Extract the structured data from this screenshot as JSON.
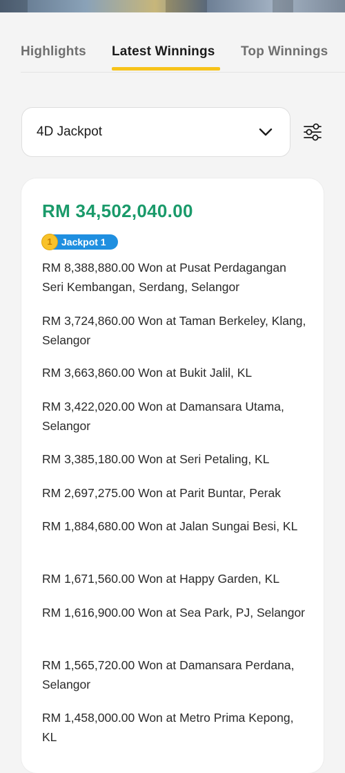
{
  "tabs": [
    {
      "label": "Highlights",
      "active": false
    },
    {
      "label": "Latest Winnings",
      "active": true
    },
    {
      "label": "Top Winnings",
      "active": false
    }
  ],
  "game_select": {
    "value": "4D Jackpot"
  },
  "icons": {
    "dropdown": "chevron-down-icon",
    "filter": "sliders-icon",
    "badge_coin": "coin-icon"
  },
  "colors": {
    "accent_tab": "#f7c31a",
    "amount_green": "#1a9a6a",
    "badge_blue": "#1f8fe0",
    "coin_gold": "#f8c22a"
  },
  "result": {
    "total_amount": "RM 34,502,040.00",
    "badge_number": "1",
    "badge_label": "Jackpot 1",
    "winnings": [
      "RM 8,388,880.00 Won at Pusat Perdagangan Seri Kembangan, Serdang, Selangor",
      "RM 3,724,860.00 Won at Taman Berkeley, Klang, Selangor",
      "RM 3,663,860.00 Won at Bukit Jalil, KL",
      "RM 3,422,020.00 Won at Damansara Utama, Selangor",
      "RM 3,385,180.00 Won at Seri Petaling, KL",
      "RM 2,697,275.00 Won at Parit Buntar, Perak",
      "RM 1,884,680.00 Won at Jalan Sungai Besi, KL",
      "RM 1,671,560.00 Won at Happy Garden, KL",
      "RM 1,616,900.00 Won at Sea Park, PJ, Selangor",
      "RM 1,565,720.00 Won at Damansara Perdana, Selangor",
      "RM 1,458,000.00 Won at Metro Prima Kepong, KL"
    ]
  }
}
